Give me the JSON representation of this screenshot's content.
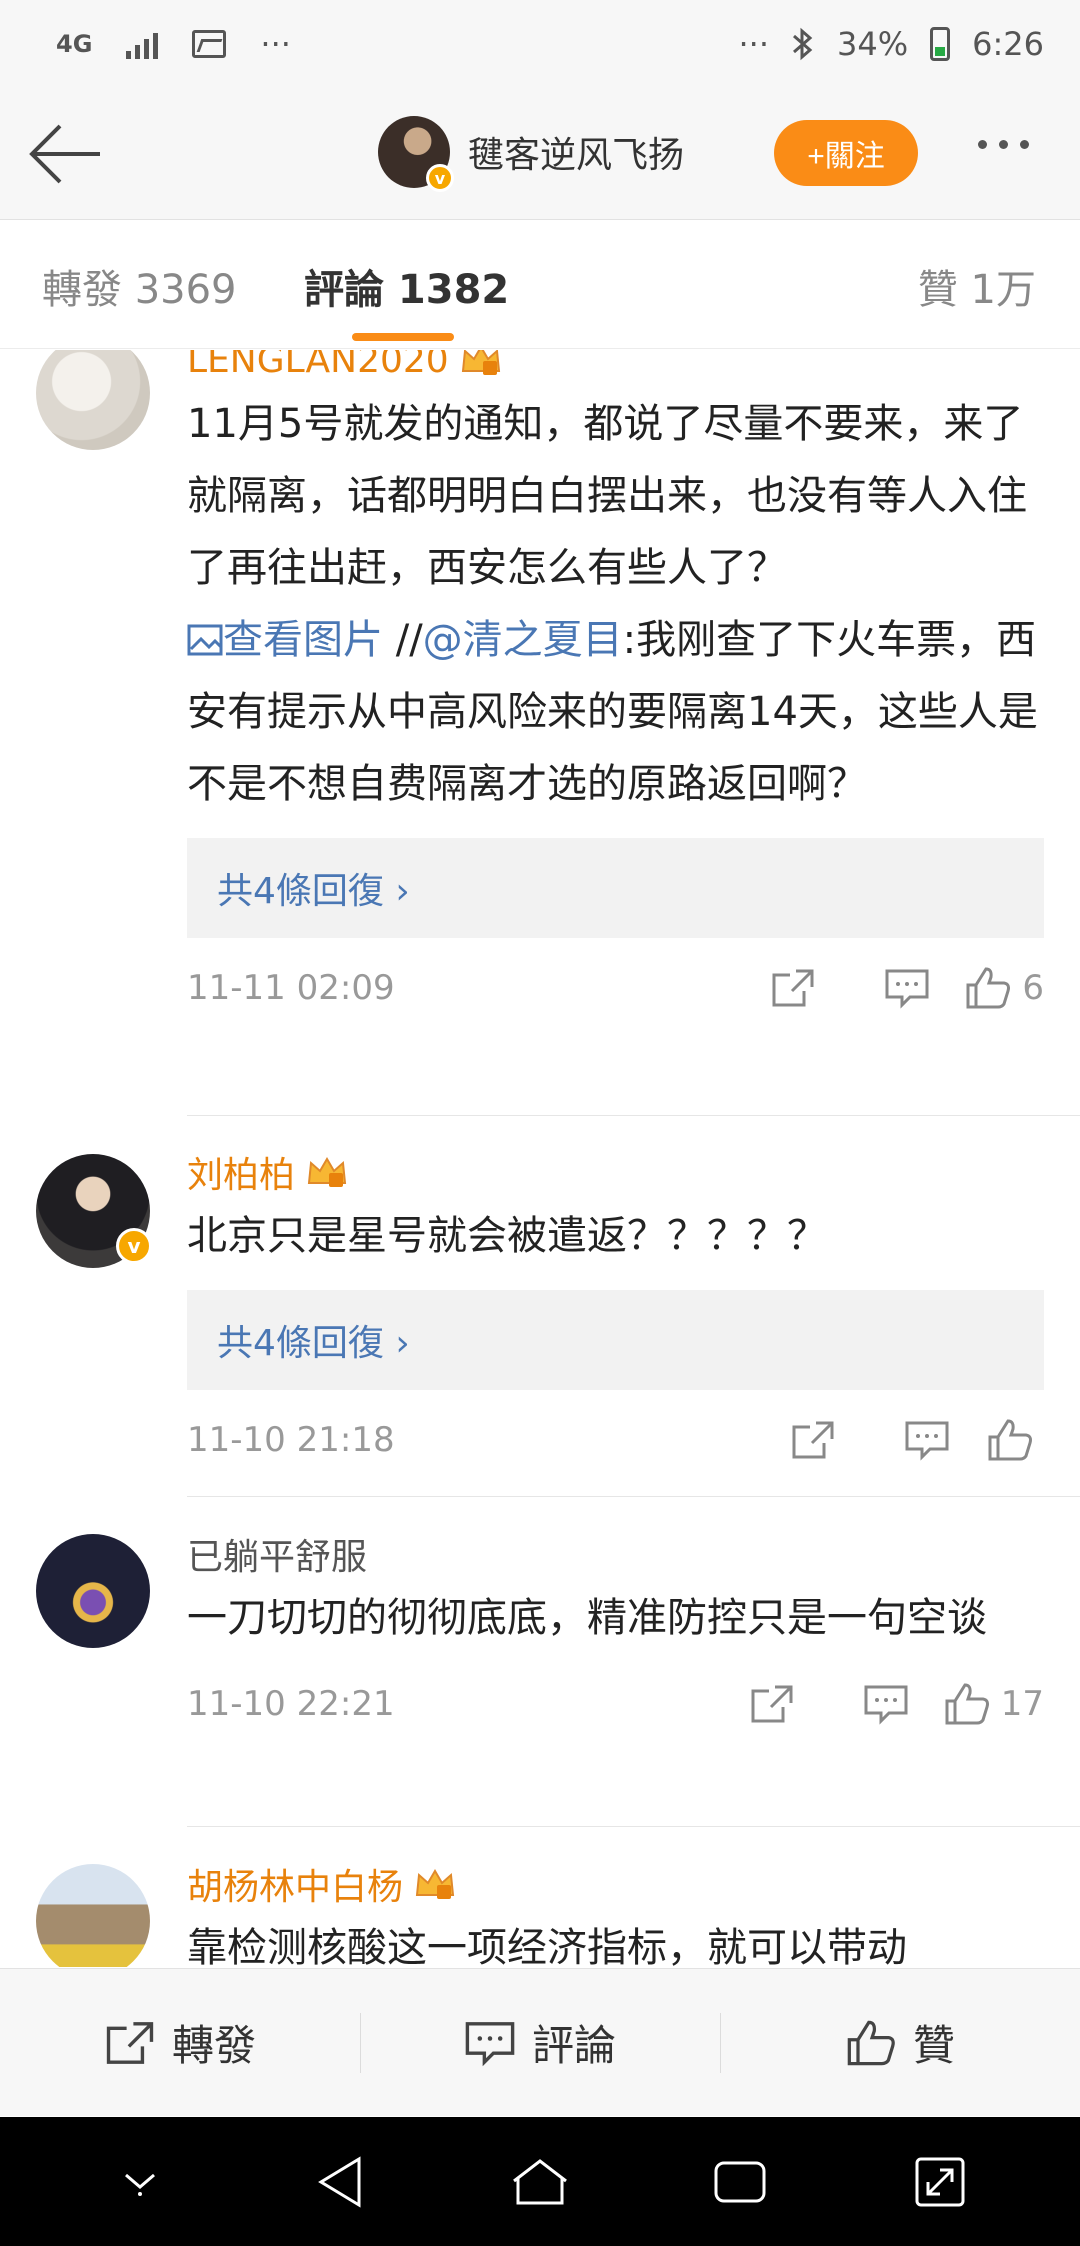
{
  "status_bar": {
    "network": "4G",
    "dots_left": "···",
    "dots_right": "···",
    "battery_percent": "34%",
    "time": "6:26"
  },
  "header": {
    "user_name": "毽客逆风飞扬",
    "follow_label": "+關注",
    "verified_mark": "v"
  },
  "tabs": {
    "repost": "轉發 3369",
    "comment": "評論 1382",
    "like": "贊 1万"
  },
  "comments": [
    {
      "user": "LENGLAN2020",
      "text_main": "11月5号就发的通知，都说了尽量不要来，来了就隔离，话都明明白白摆出来，也没有等人入住了再往出赶，西安怎么有些人了？",
      "view_image": "查看图片",
      "repost_prefix": " //",
      "mention": "@清之夏目",
      "text_rest": ":我刚查了下火车票，西安有提示从中高风险来的要隔离14天，这些人是不是不想自费隔离才选的原路返回啊？",
      "replies": "共4條回復 ›",
      "time": "11-11 02:09",
      "likes": "6"
    },
    {
      "user": "刘柏柏",
      "text_main": "北京只是星号就会被遣返？？？？？",
      "replies": "共4條回復 ›",
      "time": "11-10 21:18",
      "likes": ""
    },
    {
      "user": "已躺平舒服",
      "text_main": "一刀切切的彻彻底底，精准防控只是一句空谈",
      "time": "11-10 22:21",
      "likes": "17"
    },
    {
      "user": "胡杨林中白杨",
      "text_main": "靠检测核酸这一项经济指标，就可以带动"
    }
  ],
  "bottom_bar": {
    "repost": "轉發",
    "comment": "評論",
    "like": "贊"
  },
  "colors": {
    "accent_orange": "#fa8c16",
    "link_blue": "#4a77b4",
    "username_orange": "#e8820c"
  }
}
